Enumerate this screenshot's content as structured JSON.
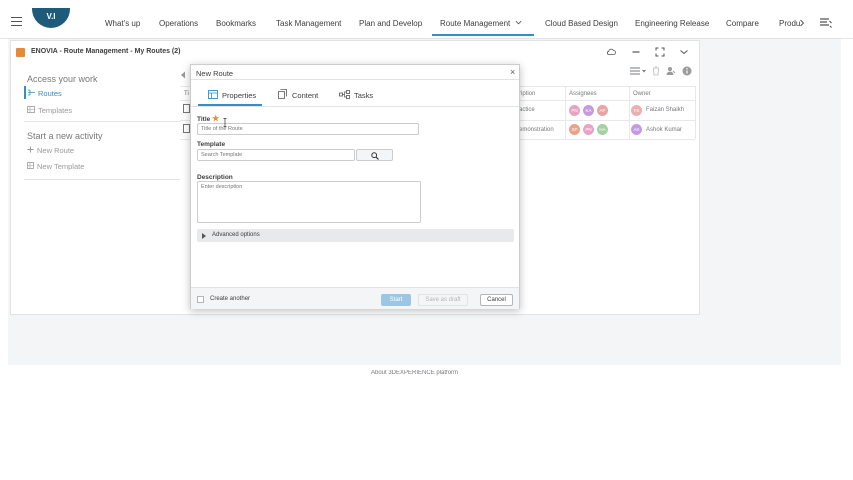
{
  "nav": {
    "logo_text": "V.I",
    "tabs": [
      "What's up",
      "Operations",
      "Bookmarks",
      "Task Management",
      "Plan and Develop",
      "Route Management",
      "Cloud Based Design",
      "Engineering Release",
      "Compare",
      "Produ"
    ],
    "active_tab": "Route Management",
    "colors": {
      "accent": "#368ec4",
      "logo": "#1e5b7a"
    }
  },
  "widget": {
    "title": "ENOVIA - Route Management - My Routes (2)"
  },
  "sidebar": {
    "section1": "Access your work",
    "items1": [
      "Routes",
      "Templates"
    ],
    "section2": "Start a new activity",
    "items2": [
      "New Route",
      "New Template"
    ]
  },
  "table": {
    "headers": [
      "Ti",
      "ription",
      "Assignees",
      "Owner"
    ],
    "rows": [
      {
        "desc": "actice",
        "assignees": [
          "PN",
          "KA",
          "AP"
        ],
        "owner_initials": "FS",
        "owner": "Faizan Shaikh"
      },
      {
        "desc": "emonstration",
        "assignees": [
          "SP",
          "PN",
          "HA"
        ],
        "owner_initials": "AK",
        "owner": "Ashok Kumar"
      }
    ]
  },
  "modal": {
    "title": "New Route",
    "close": "×",
    "tabs": [
      "Properties",
      "Content",
      "Tasks"
    ],
    "title_label": "Title",
    "required_mark": "★",
    "title_placeholder": "Title of the Route",
    "template_label": "Template",
    "template_placeholder": "Search Template",
    "description_label": "Description",
    "description_placeholder": "Enter description",
    "advanced": "Advanced options",
    "create_another": "Create another",
    "start": "Start",
    "save_draft": "Save as draft",
    "cancel": "Cancel"
  },
  "footer": {
    "about": "About 3DEXPERIENCE platform"
  }
}
